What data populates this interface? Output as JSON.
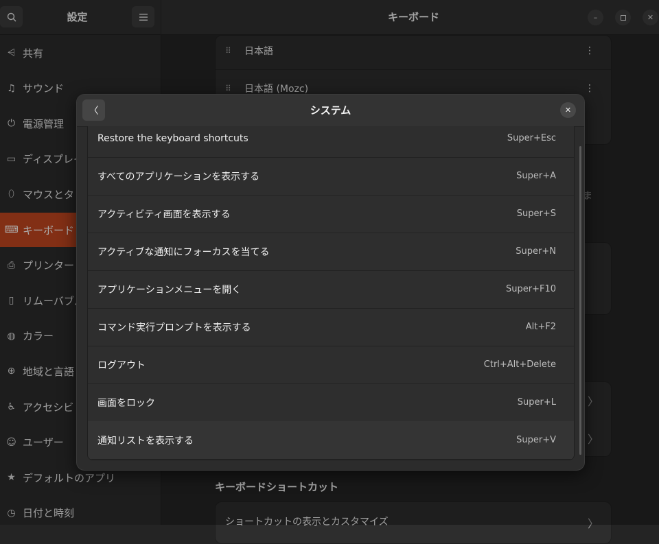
{
  "sidebar_header": {
    "title": "設定"
  },
  "main_header": {
    "title": "キーボード"
  },
  "sidebar": {
    "items": [
      {
        "label": "共有",
        "icon": "share-icon"
      },
      {
        "label": "サウンド",
        "icon": "music-note-icon"
      },
      {
        "label": "電源管理",
        "icon": "power-icon"
      },
      {
        "label": "ディスプレイ",
        "icon": "display-icon"
      },
      {
        "label": "マウスとタ",
        "icon": "mouse-icon"
      },
      {
        "label": "キーボード",
        "icon": "keyboard-icon",
        "active": true
      },
      {
        "label": "プリンター",
        "icon": "printer-icon"
      },
      {
        "label": "リムーバブル",
        "icon": "removable-media-icon"
      },
      {
        "label": "カラー",
        "icon": "color-icon"
      },
      {
        "label": "地域と言語",
        "icon": "globe-icon"
      },
      {
        "label": "アクセシビ",
        "icon": "accessibility-icon"
      },
      {
        "label": "ユーザー",
        "icon": "users-icon"
      },
      {
        "label": "デフォルトのアプリ",
        "icon": "star-icon"
      },
      {
        "label": "日付と時刻",
        "icon": "clock-icon"
      }
    ]
  },
  "input_sources": [
    {
      "label": "日本語"
    },
    {
      "label": "日本語 (Mozc)"
    }
  ],
  "background": {
    "peek_text": "ま",
    "section_title": "キーボードショートカット",
    "shortcuts_row_label": "ショートカットの表示とカスタマイズ"
  },
  "dialog": {
    "title": "システム",
    "shortcuts": [
      {
        "name": "Restore the keyboard shortcuts",
        "keys": "Super+Esc"
      },
      {
        "name": "すべてのアプリケーションを表示する",
        "keys": "Super+A"
      },
      {
        "name": "アクティビティ画面を表示する",
        "keys": "Super+S"
      },
      {
        "name": "アクティブな通知にフォーカスを当てる",
        "keys": "Super+N"
      },
      {
        "name": "アプリケーションメニューを開く",
        "keys": "Super+F10"
      },
      {
        "name": "コマンド実行プロンプトを表示する",
        "keys": "Alt+F2"
      },
      {
        "name": "ログアウト",
        "keys": "Ctrl+Alt+Delete"
      },
      {
        "name": "画面をロック",
        "keys": "Super+L"
      },
      {
        "name": "通知リストを表示する",
        "keys": "Super+V"
      }
    ]
  },
  "colors": {
    "accent": "#c0461f",
    "background": "#242424",
    "dialog": "#2c2c2c"
  }
}
